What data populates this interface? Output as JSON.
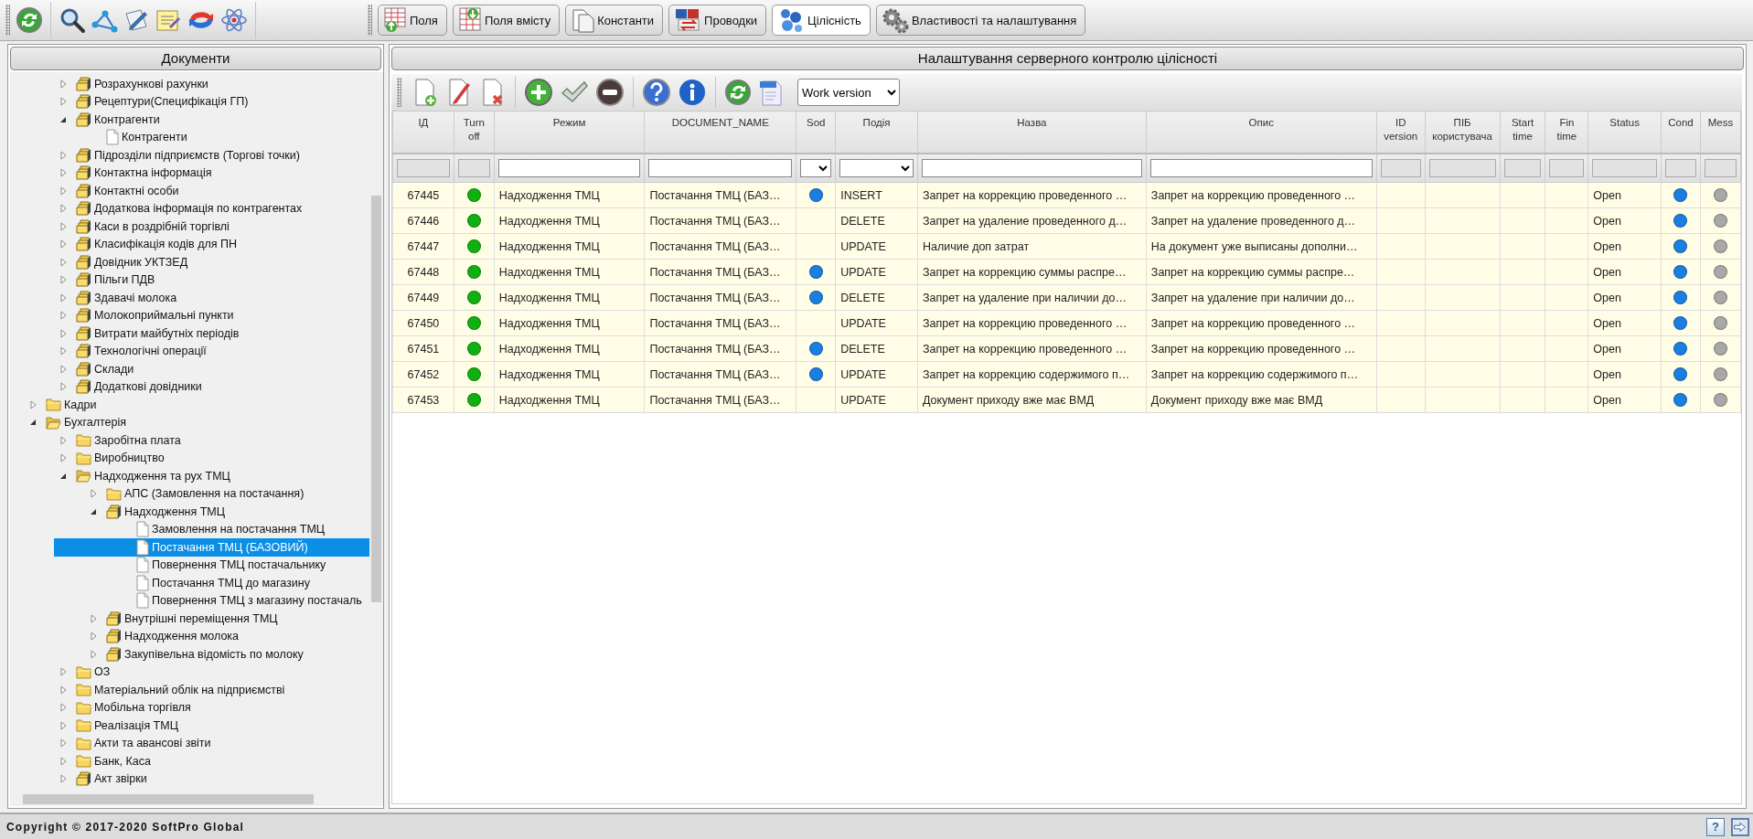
{
  "top_tabs": [
    {
      "label": "Поля",
      "selected": false
    },
    {
      "label": "Поля вмісту",
      "selected": false
    },
    {
      "label": "Константи",
      "selected": false
    },
    {
      "label": "Проводки",
      "selected": false
    },
    {
      "label": "Цілісність",
      "selected": true
    },
    {
      "label": "Властивості та налаштування",
      "selected": false
    }
  ],
  "tree": {
    "title": "Документи",
    "scrolled_group": [
      {
        "label": "Розрахункові рахунки",
        "kind": "stack",
        "expanded": false,
        "selected": false
      },
      {
        "label": "Рецептури(Специфікація ГП)",
        "kind": "stack",
        "expanded": false,
        "selected": false
      },
      {
        "label": "Контрагенти",
        "kind": "stack",
        "expanded": true,
        "selected": false,
        "children": [
          {
            "label": "Контрагенти",
            "kind": "doc",
            "selected": false
          }
        ]
      },
      {
        "label": "Підрозділи підприємств (Торгові точки)",
        "kind": "stack",
        "expanded": false,
        "selected": false
      },
      {
        "label": "Контактна інформація",
        "kind": "stack",
        "expanded": false,
        "selected": false
      },
      {
        "label": "Контактні особи",
        "kind": "stack",
        "expanded": false,
        "selected": false
      },
      {
        "label": "Додаткова інформація по контрагентах",
        "kind": "stack",
        "expanded": false,
        "selected": false
      },
      {
        "label": "Каси в роздрібній торгівлі",
        "kind": "stack",
        "expanded": false,
        "selected": false
      },
      {
        "label": "Класифікація кодів для ПН",
        "kind": "stack",
        "expanded": false,
        "selected": false
      },
      {
        "label": "Довідник УКТЗЕД",
        "kind": "stack",
        "expanded": false,
        "selected": false
      },
      {
        "label": "Пільги ПДВ",
        "kind": "stack",
        "expanded": false,
        "selected": false
      },
      {
        "label": "Здавачі молока",
        "kind": "stack",
        "expanded": false,
        "selected": false
      },
      {
        "label": "Молокоприймальні пункти",
        "kind": "stack",
        "expanded": false,
        "selected": false
      },
      {
        "label": "Витрати майбутніх періодів",
        "kind": "stack",
        "expanded": false,
        "selected": false
      },
      {
        "label": "Технологічні операції",
        "kind": "stack",
        "expanded": false,
        "selected": false
      },
      {
        "label": "Склади",
        "kind": "stack",
        "expanded": false,
        "selected": false
      },
      {
        "label": "Додаткові довідники",
        "kind": "stack",
        "expanded": false,
        "selected": false
      }
    ],
    "items": [
      {
        "label": "Кадри",
        "kind": "folder",
        "expanded": false,
        "selected": false
      },
      {
        "label": "Бухгалтерія",
        "kind": "folder",
        "expanded": true,
        "selected": false,
        "children": [
          {
            "label": "Заробітна плата",
            "kind": "folder",
            "expanded": false,
            "selected": false
          },
          {
            "label": "Виробництво",
            "kind": "folder",
            "expanded": false,
            "selected": false
          },
          {
            "label": "Надходження та рух ТМЦ",
            "kind": "folder",
            "expanded": true,
            "selected": false,
            "children": [
              {
                "label": "АПС (Замовлення на постачання)",
                "kind": "folder",
                "expanded": false,
                "selected": false
              },
              {
                "label": "Надходження ТМЦ",
                "kind": "stack",
                "expanded": true,
                "selected": false,
                "children": [
                  {
                    "label": "Замовлення на постачання ТМЦ",
                    "kind": "doc",
                    "selected": false
                  },
                  {
                    "label": "Постачання ТМЦ (БАЗОВИЙ)",
                    "kind": "doc",
                    "selected": true
                  },
                  {
                    "label": "Повернення ТМЦ постачальнику",
                    "kind": "doc",
                    "selected": false
                  },
                  {
                    "label": "Постачання ТМЦ до магазину",
                    "kind": "doc",
                    "selected": false
                  },
                  {
                    "label": "Повернення ТМЦ з магазину постачаль",
                    "kind": "doc",
                    "selected": false
                  }
                ]
              },
              {
                "label": "Внутрішні переміщення ТМЦ",
                "kind": "stack",
                "expanded": false,
                "selected": false
              },
              {
                "label": "Надходження молока",
                "kind": "stack",
                "expanded": false,
                "selected": false
              },
              {
                "label": "Закупівельна відомість по молоку",
                "kind": "stack",
                "expanded": false,
                "selected": false
              }
            ]
          },
          {
            "label": "ОЗ",
            "kind": "folder",
            "expanded": false,
            "selected": false
          },
          {
            "label": "Матеріальний облік на підприємстві",
            "kind": "folder",
            "expanded": false,
            "selected": false
          },
          {
            "label": "Мобільна торгівля",
            "kind": "folder",
            "expanded": false,
            "selected": false
          },
          {
            "label": "Реалізація ТМЦ",
            "kind": "folder",
            "expanded": false,
            "selected": false
          },
          {
            "label": "Акти та авансові звіти",
            "kind": "folder",
            "expanded": false,
            "selected": false
          },
          {
            "label": "Банк, Каса",
            "kind": "folder",
            "expanded": false,
            "selected": false
          },
          {
            "label": "Акт звірки",
            "kind": "stack",
            "expanded": false,
            "selected": false
          }
        ]
      }
    ]
  },
  "main": {
    "title": "Налаштування серверного контролю цілісності",
    "version_select": {
      "value": "Work version"
    },
    "table": {
      "columns": [
        {
          "label": "ІД"
        },
        {
          "label": "Turn off"
        },
        {
          "label": "Режим"
        },
        {
          "label": "DOCUMENT_NAME"
        },
        {
          "label": "Sod"
        },
        {
          "label": "Подія"
        },
        {
          "label": "Назва"
        },
        {
          "label": "Опис"
        },
        {
          "label": "ID version"
        },
        {
          "label": "ПІБ користувача"
        },
        {
          "label": "Start time"
        },
        {
          "label": "Fin time"
        },
        {
          "label": "Status"
        },
        {
          "label": "Cond"
        },
        {
          "label": "Mess"
        }
      ],
      "filters": [
        {
          "kind": "disabled"
        },
        {
          "kind": "disabled"
        },
        {
          "kind": "text"
        },
        {
          "kind": "text"
        },
        {
          "kind": "select"
        },
        {
          "kind": "select"
        },
        {
          "kind": "text"
        },
        {
          "kind": "text"
        },
        {
          "kind": "disabled"
        },
        {
          "kind": "disabled"
        },
        {
          "kind": "disabled"
        },
        {
          "kind": "disabled"
        },
        {
          "kind": "disabled"
        },
        {
          "kind": "disabled"
        },
        {
          "kind": "disabled"
        }
      ],
      "rows": [
        {
          "id": "67445",
          "active": true,
          "mode": "Надходження ТМЦ",
          "document_name": "Постачання ТМЦ (БАЗ…",
          "sod": true,
          "event": "INSERT",
          "name": "Запрет на коррекцию проведенного …",
          "description": "Запрет на коррекцию проведенного …",
          "status": "Open",
          "cond": true,
          "mess": false
        },
        {
          "id": "67446",
          "active": true,
          "mode": "Надходження ТМЦ",
          "document_name": "Постачання ТМЦ (БАЗ…",
          "sod": false,
          "event": "DELETE",
          "name": "Запрет на удаление проведенного д…",
          "description": "Запрет на удаление проведенного д…",
          "status": "Open",
          "cond": true,
          "mess": false
        },
        {
          "id": "67447",
          "active": true,
          "mode": "Надходження ТМЦ",
          "document_name": "Постачання ТМЦ (БАЗ…",
          "sod": false,
          "event": "UPDATE",
          "name": "Наличие доп затрат",
          "description": "На документ уже выписаны дополни…",
          "status": "Open",
          "cond": true,
          "mess": false
        },
        {
          "id": "67448",
          "active": true,
          "mode": "Надходження ТМЦ",
          "document_name": "Постачання ТМЦ (БАЗ…",
          "sod": true,
          "event": "UPDATE",
          "name": "Запрет на коррекцию суммы распре…",
          "description": "Запрет на коррекцию суммы распре…",
          "status": "Open",
          "cond": true,
          "mess": false
        },
        {
          "id": "67449",
          "active": true,
          "mode": "Надходження ТМЦ",
          "document_name": "Постачання ТМЦ (БАЗ…",
          "sod": true,
          "event": "DELETE",
          "name": "Запрет на удаление при наличии до…",
          "description": "Запрет на удаление при наличии до…",
          "status": "Open",
          "cond": true,
          "mess": false
        },
        {
          "id": "67450",
          "active": true,
          "mode": "Надходження ТМЦ",
          "document_name": "Постачання ТМЦ (БАЗ…",
          "sod": false,
          "event": "UPDATE",
          "name": "Запрет на коррекцию проведенного …",
          "description": "Запрет на коррекцию проведенного …",
          "status": "Open",
          "cond": true,
          "mess": false
        },
        {
          "id": "67451",
          "active": true,
          "mode": "Надходження ТМЦ",
          "document_name": "Постачання ТМЦ (БАЗ…",
          "sod": true,
          "event": "DELETE",
          "name": "Запрет на коррекцию проведенного …",
          "description": "Запрет на коррекцию проведенного …",
          "status": "Open",
          "cond": true,
          "mess": false
        },
        {
          "id": "67452",
          "active": true,
          "mode": "Надходження ТМЦ",
          "document_name": "Постачання ТМЦ (БАЗ…",
          "sod": true,
          "event": "UPDATE",
          "name": "Запрет на коррекцию содержимого п…",
          "description": "Запрет на коррекцию содержимого п…",
          "status": "Open",
          "cond": true,
          "mess": false
        },
        {
          "id": "67453",
          "active": true,
          "mode": "Надходження ТМЦ",
          "document_name": "Постачання ТМЦ (БАЗ…",
          "sod": false,
          "event": "UPDATE",
          "name": "Документ приходу вже має ВМД",
          "description": "Документ приходу вже має ВМД",
          "status": "Open",
          "cond": true,
          "mess": false
        }
      ]
    }
  },
  "footer": {
    "copyright": "Copyright © 2017-2020 SoftPro Global",
    "help_button": "?"
  }
}
